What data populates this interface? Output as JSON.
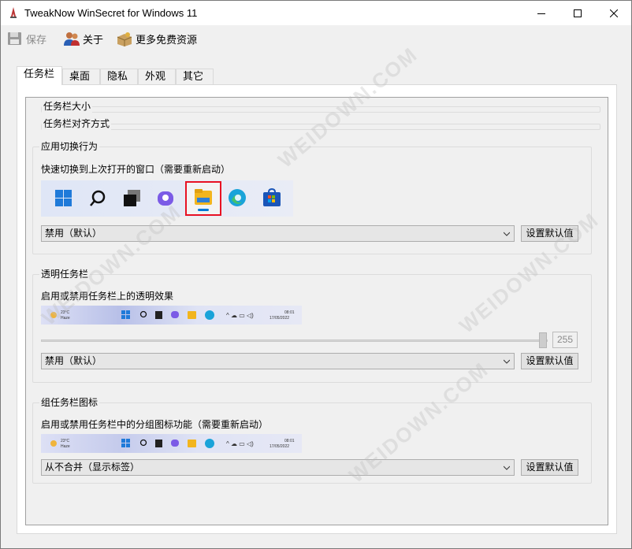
{
  "window": {
    "title": "TweakNow WinSecret for Windows 11"
  },
  "toolbar": {
    "save_label": "保存",
    "about_label": "关于",
    "more_label": "更多免费资源"
  },
  "tabs": [
    {
      "label": "任务栏"
    },
    {
      "label": "桌面"
    },
    {
      "label": "隐私"
    },
    {
      "label": "外观"
    },
    {
      "label": "其它"
    }
  ],
  "sections": {
    "size": {
      "title": "任务栏大小"
    },
    "alignment": {
      "title": "任务栏对齐方式"
    },
    "app_switch": {
      "title": "应用切换行为",
      "description": "快速切换到上次打开的窗口（需要重新启动）",
      "dropdown_value": "禁用（默认）",
      "reset_label": "设置默认值"
    },
    "transparency": {
      "title": "透明任务栏",
      "description": "启用或禁用任务栏上的透明效果",
      "slider_value": "255",
      "dropdown_value": "禁用（默认）",
      "reset_label": "设置默认值"
    },
    "grouping": {
      "title": "组任务栏图标",
      "description": "启用或禁用任务栏中的分组图标功能（需要重新启动）",
      "dropdown_value": "从不合并（显示标签）",
      "reset_label": "设置默认值"
    }
  },
  "taskbar_preview": {
    "weather_temp": "23°C",
    "weather_text": "Haze",
    "clock_time": "08:01",
    "clock_date": "17/05/2022"
  },
  "watermark": "WEIDOWN.COM",
  "colors": {
    "accent": "#0078d4",
    "highlight_border": "#e81123"
  }
}
